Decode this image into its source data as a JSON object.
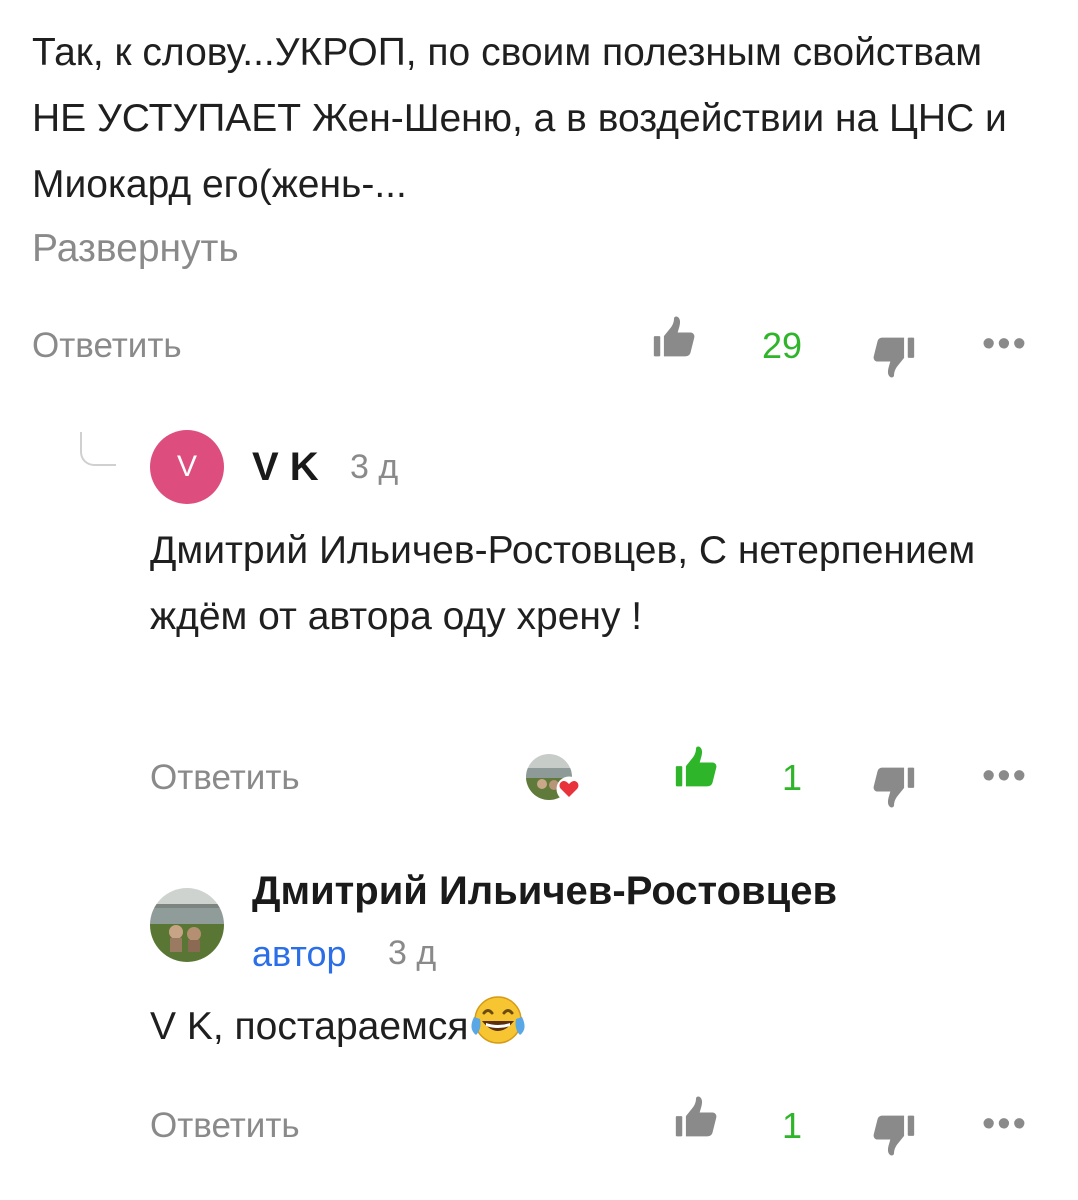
{
  "comment1": {
    "text": "Так, к слову...УКРОП, по своим полезным свойствам НЕ УСТУПАЕТ Жен-Шеню, а в воздействии на ЦНС и Миокард его(жень-...",
    "expand_label": "Развернуть",
    "reply_label": "Ответить",
    "likes": "29"
  },
  "comment2": {
    "avatar_letter": "V",
    "author": "V K",
    "time": "3 д",
    "text": "Дмитрий Ильичев-Ростовцев, С нетерпением ждём от автора оду хрену !",
    "reply_label": "Ответить",
    "likes": "1"
  },
  "comment3": {
    "author": "Дмитрий Ильичев-Ростовцев",
    "author_badge": "автор",
    "time": "3 д",
    "text": "V K, постараемся",
    "reply_label": "Ответить",
    "likes": "1"
  },
  "icons": {
    "like": "thumbs-up-icon",
    "dislike": "thumbs-down-icon",
    "more": "more-dots-icon",
    "emoji": "tears-of-joy-emoji",
    "heart": "heart-badge-icon"
  },
  "colors": {
    "accent_green": "#2fb52a",
    "muted_gray": "#8a8a8a",
    "author_blue": "#2a6ee8",
    "avatar_pink": "#dd4e7f"
  }
}
